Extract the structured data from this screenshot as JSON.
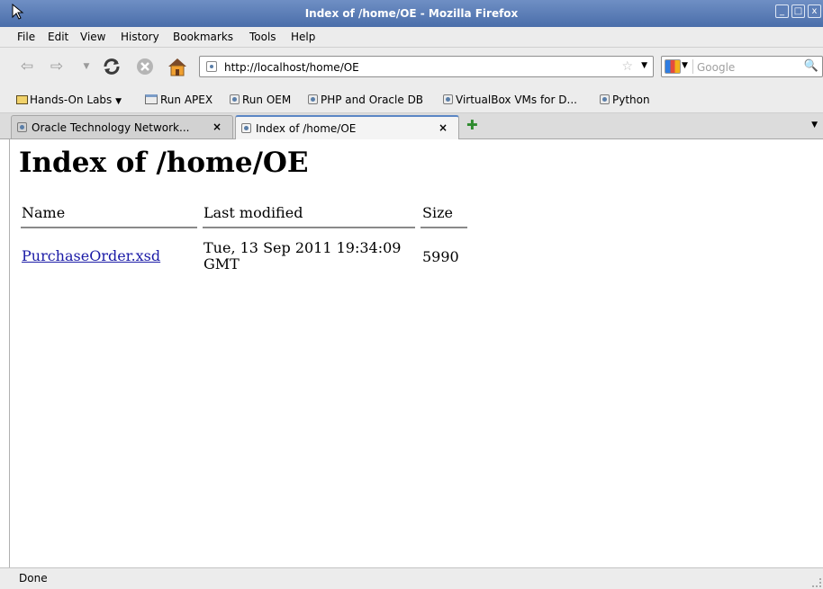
{
  "window": {
    "title": "Index of /home/OE - Mozilla Firefox",
    "buttons": [
      "_",
      "□",
      "x"
    ]
  },
  "menu": [
    "File",
    "Edit",
    "View",
    "History",
    "Bookmarks",
    "Tools",
    "Help"
  ],
  "nav": {
    "url": "http://localhost/home/OE",
    "search_placeholder": "Google"
  },
  "bookmarks": [
    "Hands-On Labs",
    "Run APEX",
    "Run OEM",
    "PHP and Oracle DB",
    "VirtualBox VMs for D...",
    "Python"
  ],
  "tabs": [
    {
      "label": "Oracle Technology Network...",
      "close": "×"
    },
    {
      "label": "Index of /home/OE",
      "close": "×"
    }
  ],
  "page": {
    "heading": "Index of /home/OE",
    "columns": [
      "Name",
      "Last modified",
      "Size"
    ],
    "rows": [
      {
        "name": "PurchaseOrder.xsd",
        "modified_line1": "Tue, 13 Sep 2011 19:34:09",
        "modified_line2": "GMT",
        "size": "5990"
      }
    ]
  },
  "status": "Done",
  "colors": {
    "title_bar": "#4a6eaa",
    "link": "#1a1aa6",
    "active_tab_accent": "#5a86c4"
  },
  "icons": [
    "back-icon",
    "forward-icon",
    "history-dropdown-icon",
    "reload-icon",
    "stop-icon",
    "home-icon",
    "bookmark-star-icon",
    "search-icon",
    "new-tab-icon",
    "tab-list-icon"
  ]
}
